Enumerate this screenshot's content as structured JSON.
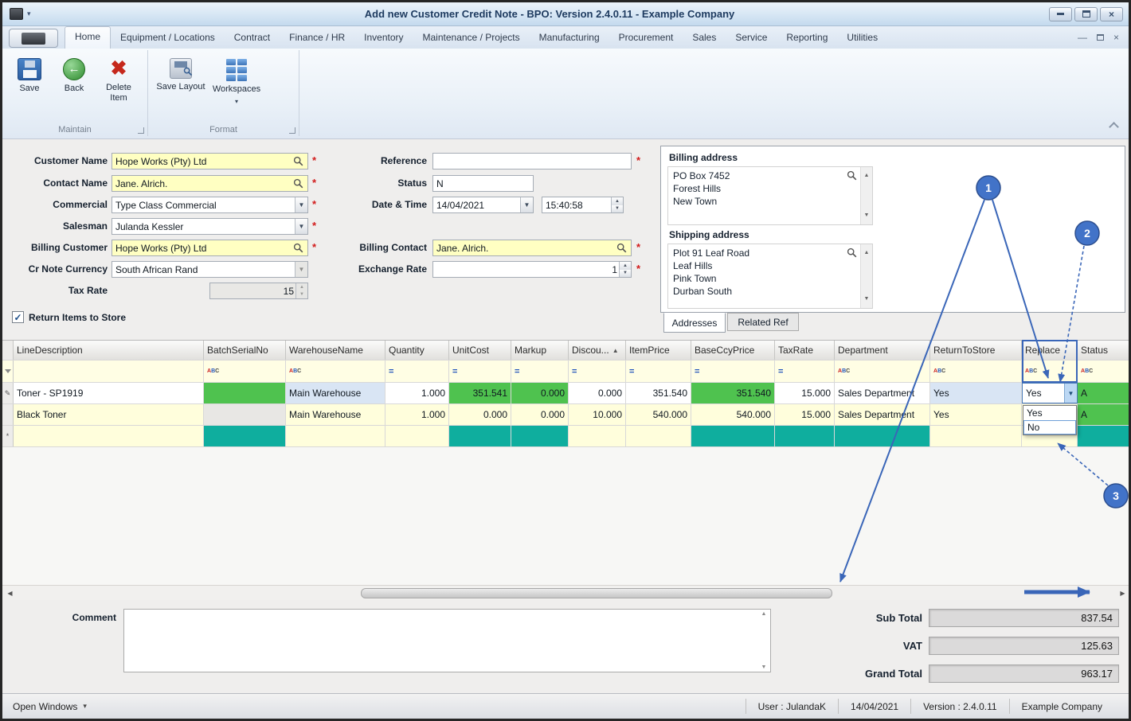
{
  "window": {
    "title": "Add new Customer Credit Note - BPO: Version 2.4.0.11 - Example Company"
  },
  "ribbon": {
    "tabs": [
      "Home",
      "Equipment / Locations",
      "Contract",
      "Finance / HR",
      "Inventory",
      "Maintenance / Projects",
      "Manufacturing",
      "Procurement",
      "Sales",
      "Service",
      "Reporting",
      "Utilities"
    ],
    "buttons": {
      "save": "Save",
      "back": "Back",
      "delete_item": "Delete Item",
      "save_layout": "Save Layout",
      "workspaces": "Workspaces"
    },
    "groups": {
      "maintain": "Maintain",
      "format": "Format"
    }
  },
  "form": {
    "required_marker": "*",
    "customer_name": {
      "label": "Customer Name",
      "value": "Hope Works (Pty) Ltd"
    },
    "contact_name": {
      "label": "Contact Name",
      "value": "Jane. Alrich."
    },
    "commercial": {
      "label": "Commercial",
      "value": "Type Class Commercial"
    },
    "salesman": {
      "label": "Salesman",
      "value": "Julanda Kessler"
    },
    "billing_customer": {
      "label": "Billing Customer",
      "value": "Hope Works (Pty) Ltd"
    },
    "cr_note_currency": {
      "label": "Cr Note Currency",
      "value": "South African Rand"
    },
    "tax_rate": {
      "label": "Tax Rate",
      "value": "15"
    },
    "reference": {
      "label": "Reference",
      "value": ""
    },
    "status": {
      "label": "Status",
      "value": "N"
    },
    "date_time": {
      "label": "Date & Time",
      "date": "14/04/2021",
      "time": "15:40:58"
    },
    "billing_contact": {
      "label": "Billing Contact",
      "value": "Jane. Alrich."
    },
    "exchange_rate": {
      "label": "Exchange Rate",
      "value": "1"
    },
    "return_items": {
      "label": "Return Items to Store",
      "checked": true
    }
  },
  "addresses": {
    "billing_label": "Billing address",
    "billing_lines": [
      "PO Box 7452",
      "Forest Hills",
      "New Town"
    ],
    "shipping_label": "Shipping address",
    "shipping_lines": [
      "Plot 91 Leaf Road",
      "Leaf Hills",
      "Pink Town",
      "Durban South"
    ],
    "tabs": [
      "Addresses",
      "Related Ref"
    ]
  },
  "grid": {
    "columns": [
      "LineDescription",
      "BatchSerialNo",
      "WarehouseName",
      "Quantity",
      "UnitCost",
      "Markup",
      "Discou...",
      "ItemPrice",
      "BaseCcyPrice",
      "TaxRate",
      "Department",
      "ReturnToStore",
      "Replace",
      "Status"
    ],
    "sorted_column_index": 6,
    "rows": [
      {
        "cells": [
          "Toner - SP1919",
          "",
          "Main Warehouse",
          "1.000",
          "351.541",
          "0.000",
          "0.000",
          "351.540",
          "351.540",
          "15.000",
          "Sales Department",
          "Yes",
          "Yes",
          "A"
        ]
      },
      {
        "cells": [
          "Black Toner",
          "",
          "Main Warehouse",
          "1.000",
          "0.000",
          "0.000",
          "10.000",
          "540.000",
          "540.000",
          "15.000",
          "Sales Department",
          "Yes",
          "",
          "A"
        ]
      },
      {
        "cells": [
          "",
          "",
          "",
          "",
          "",
          "",
          "",
          "",
          "",
          "",
          "",
          "",
          "",
          ""
        ]
      }
    ],
    "replace_dropdown": {
      "value": "Yes",
      "options": [
        "Yes",
        "No"
      ]
    }
  },
  "comment": {
    "label": "Comment",
    "value": ""
  },
  "totals": {
    "sub_total_label": "Sub Total",
    "sub_total": "837.54",
    "vat_label": "VAT",
    "vat": "125.63",
    "grand_total_label": "Grand Total",
    "grand_total": "963.17"
  },
  "statusbar": {
    "open_windows": "Open Windows",
    "user": "User : JulandaK",
    "date": "14/04/2021",
    "version": "Version : 2.4.0.11",
    "company": "Example Company"
  },
  "annotations": {
    "labels": [
      "1",
      "2",
      "3"
    ]
  },
  "icons": {
    "up": "▲",
    "down": "▼",
    "left": "◀",
    "right": "▶",
    "caret_down": "▾",
    "close": "×",
    "minimize": "—",
    "check": "✓",
    "edit_pencil": "✎",
    "new_row": "*",
    "sort_asc": "▲",
    "back_arrow": "←",
    "delete_x": "✖",
    "filter_a": "A",
    "filter_b": "B",
    "filter_c": "C",
    "filter_eq": "="
  },
  "colors": {
    "accent": "#3A66B8",
    "green": "#4FC24F",
    "teal": "#0FAE9E",
    "lightblue": "#D9E5F4",
    "yellowf": "#FFFFC2",
    "rowy": "#FFFEDC",
    "filtery": "#FFFEE4"
  }
}
